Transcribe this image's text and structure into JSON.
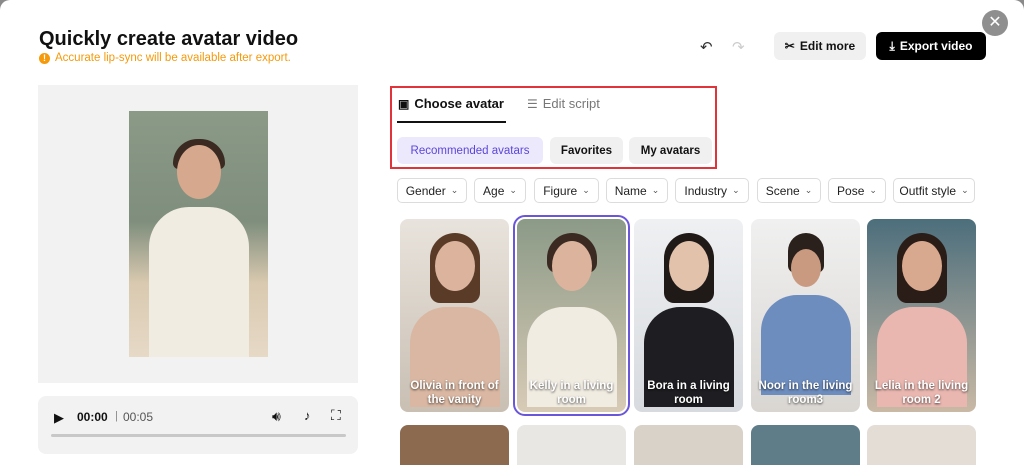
{
  "header": {
    "title": "Quickly create avatar video",
    "warning": "Accurate lip-sync will be available after export.",
    "edit_more": "Edit more",
    "export_video": "Export video"
  },
  "player": {
    "current_time": "00:00",
    "separator": "|",
    "total_time": "00:05",
    "progress": 0
  },
  "tabs": {
    "choose_avatar": "Choose avatar",
    "edit_script": "Edit script"
  },
  "chips": {
    "recommended": "Recommended avatars",
    "favorites": "Favorites",
    "my_avatars": "My avatars"
  },
  "filters": [
    "Gender",
    "Age",
    "Figure",
    "Name",
    "Industry",
    "Scene",
    "Pose",
    "Outfit style"
  ],
  "avatars": [
    {
      "name": "Olivia in front of the vanity",
      "selected": false
    },
    {
      "name": "Kelly in a living room",
      "selected": true
    },
    {
      "name": "Bora in a living room",
      "selected": false
    },
    {
      "name": "Noor in the living room3",
      "selected": false
    },
    {
      "name": "Lelia in the living room 2",
      "selected": false
    }
  ],
  "colors": {
    "accent": "#5b46d9",
    "warning": "#f59a0b",
    "highlight_box": "#e0333a"
  }
}
